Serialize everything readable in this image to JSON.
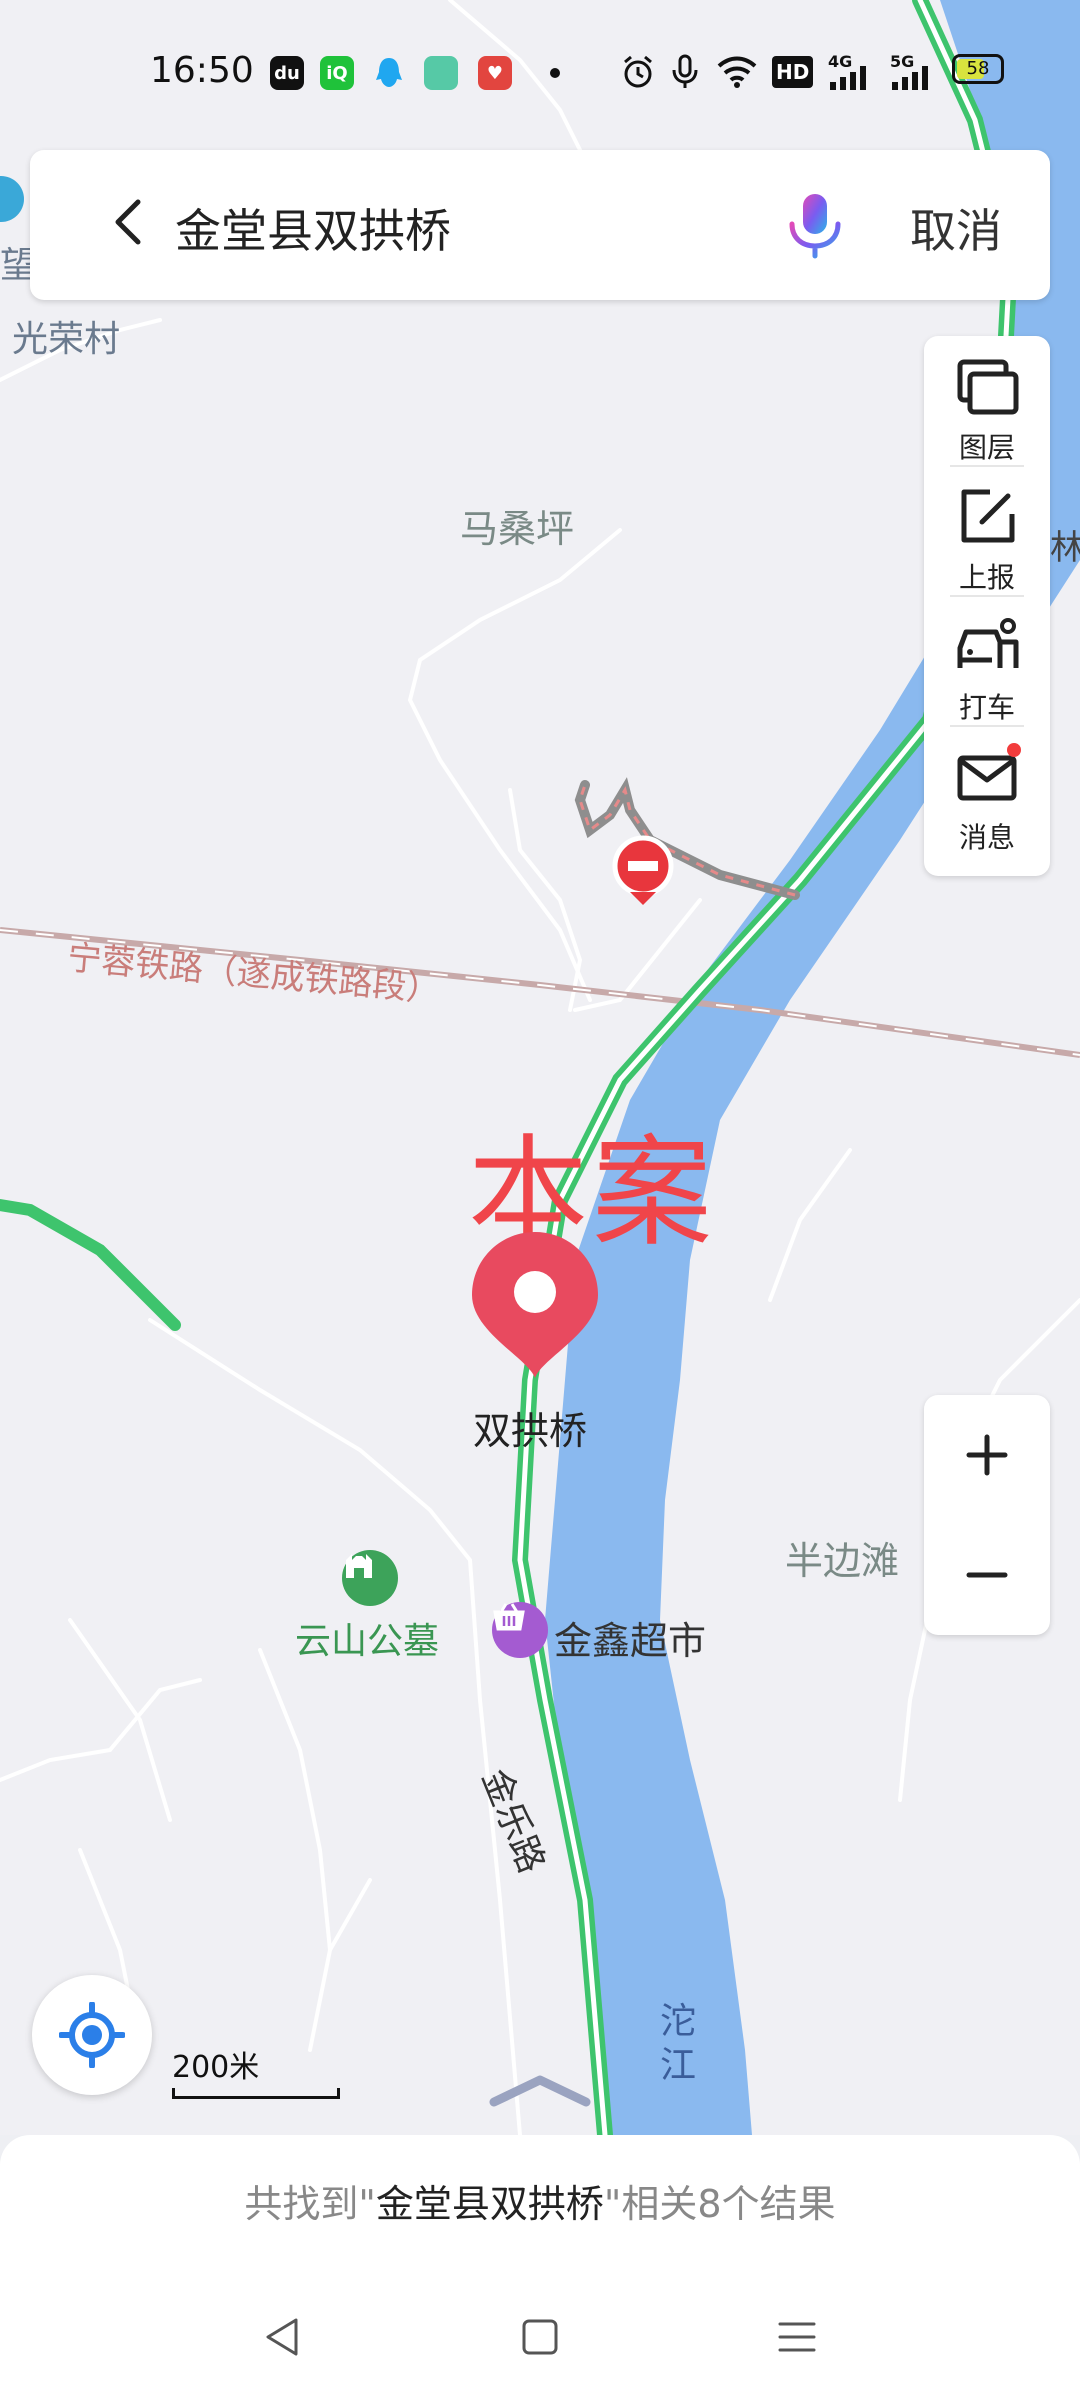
{
  "status_bar": {
    "time": "16:50",
    "battery": "58",
    "network_labels": [
      "HD",
      "4G",
      "5G"
    ]
  },
  "search": {
    "query": "金堂县双拱桥",
    "cancel_label": "取消"
  },
  "tools": [
    {
      "label": "图层",
      "icon": "layers-icon"
    },
    {
      "label": "上报",
      "icon": "report-edit-icon"
    },
    {
      "label": "打车",
      "icon": "taxi-icon"
    },
    {
      "label": "消息",
      "icon": "mail-icon"
    }
  ],
  "map": {
    "places": {
      "guangrong": "光荣村",
      "wang": "望",
      "masangping": "马桑坪",
      "banbiantan": "半边滩",
      "lin": "林",
      "railway": "宁蓉铁路（遂成铁路段）",
      "yunshan": "云山公墓",
      "jinxin": "金鑫超市",
      "jinle_road": "金乐路",
      "tuojiang": "沱江"
    },
    "annotation": "本案",
    "pin_label": "双拱桥",
    "scale_label": "200米"
  },
  "results": {
    "prefix": "共找到\"",
    "keyword": "金堂县双拱桥",
    "suffix": "\"相关8个结果"
  },
  "colors": {
    "river": "#8ab9ef",
    "road_green": "#3ec46d",
    "pin_red": "#e84a5f",
    "annotation_red": "#f0454a",
    "railway": "#c9a9a9"
  }
}
